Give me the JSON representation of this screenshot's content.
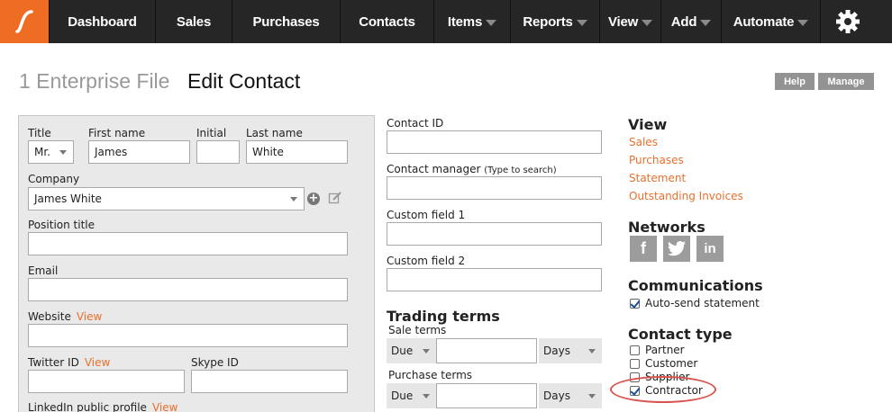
{
  "nav": {
    "items": [
      {
        "label": "Dashboard",
        "has_menu": false
      },
      {
        "label": "Sales",
        "has_menu": false
      },
      {
        "label": "Purchases",
        "has_menu": false
      },
      {
        "label": "Contacts",
        "has_menu": false
      },
      {
        "label": "Items",
        "has_menu": true
      },
      {
        "label": "Reports",
        "has_menu": true
      },
      {
        "label": "View",
        "has_menu": true
      },
      {
        "label": "Add",
        "has_menu": true
      },
      {
        "label": "Automate",
        "has_menu": true
      }
    ],
    "logo_icon": "saasu-logo-icon",
    "settings_icon": "gear-icon",
    "accent": "#ef6d23",
    "background": "#262626"
  },
  "header": {
    "file_name": "1 Enterprise File",
    "title": "Edit Contact",
    "help_label": "Help",
    "manage_label": "Manage"
  },
  "form": {
    "title_label": "Title",
    "title_value": "Mr.",
    "first_name_label": "First name",
    "first_name_value": "James",
    "initial_label": "Initial",
    "initial_value": "",
    "last_name_label": "Last name",
    "last_name_value": "White",
    "company_label": "Company",
    "company_value": "James White",
    "position_label": "Position title",
    "position_value": "",
    "email_label": "Email",
    "email_value": "",
    "website_label": "Website",
    "website_link": "View",
    "website_value": "",
    "twitter_label": "Twitter ID",
    "twitter_link": "View",
    "twitter_value": "",
    "skype_label": "Skype ID",
    "skype_value": "",
    "linkedin_label": "LinkedIn public profile",
    "linkedin_link": "View"
  },
  "middle": {
    "contact_id_label": "Contact ID",
    "contact_id_value": "",
    "contact_manager_label": "Contact manager",
    "contact_manager_hint": "(Type to search)",
    "contact_manager_value": "",
    "custom1_label": "Custom field 1",
    "custom1_value": "",
    "custom2_label": "Custom field 2",
    "custom2_value": "",
    "trading_terms_title": "Trading terms",
    "sale_terms_label": "Sale terms",
    "sale_terms_type": "Due",
    "sale_terms_value": "",
    "sale_terms_unit": "Days",
    "purchase_terms_label": "Purchase terms",
    "purchase_terms_type": "Due",
    "purchase_terms_value": "",
    "purchase_terms_unit": "Days"
  },
  "sidebar": {
    "view_title": "View",
    "view_links": [
      "Sales",
      "Purchases",
      "Statement",
      "Outstanding Invoices"
    ],
    "networks_title": "Networks",
    "networks": [
      {
        "icon": "facebook-icon",
        "glyph": "f"
      },
      {
        "icon": "twitter-icon",
        "glyph": "🐦"
      },
      {
        "icon": "linkedin-icon",
        "glyph": "in"
      }
    ],
    "communications_title": "Communications",
    "auto_send_label": "Auto-send statement",
    "auto_send_checked": true,
    "contact_type_title": "Contact type",
    "contact_types": [
      {
        "label": "Partner",
        "checked": false
      },
      {
        "label": "Customer",
        "checked": false
      },
      {
        "label": "Supplier",
        "checked": false
      },
      {
        "label": "Contractor",
        "checked": true
      }
    ],
    "link_color": "#e7702d",
    "highlight_color": "#d9534f"
  }
}
